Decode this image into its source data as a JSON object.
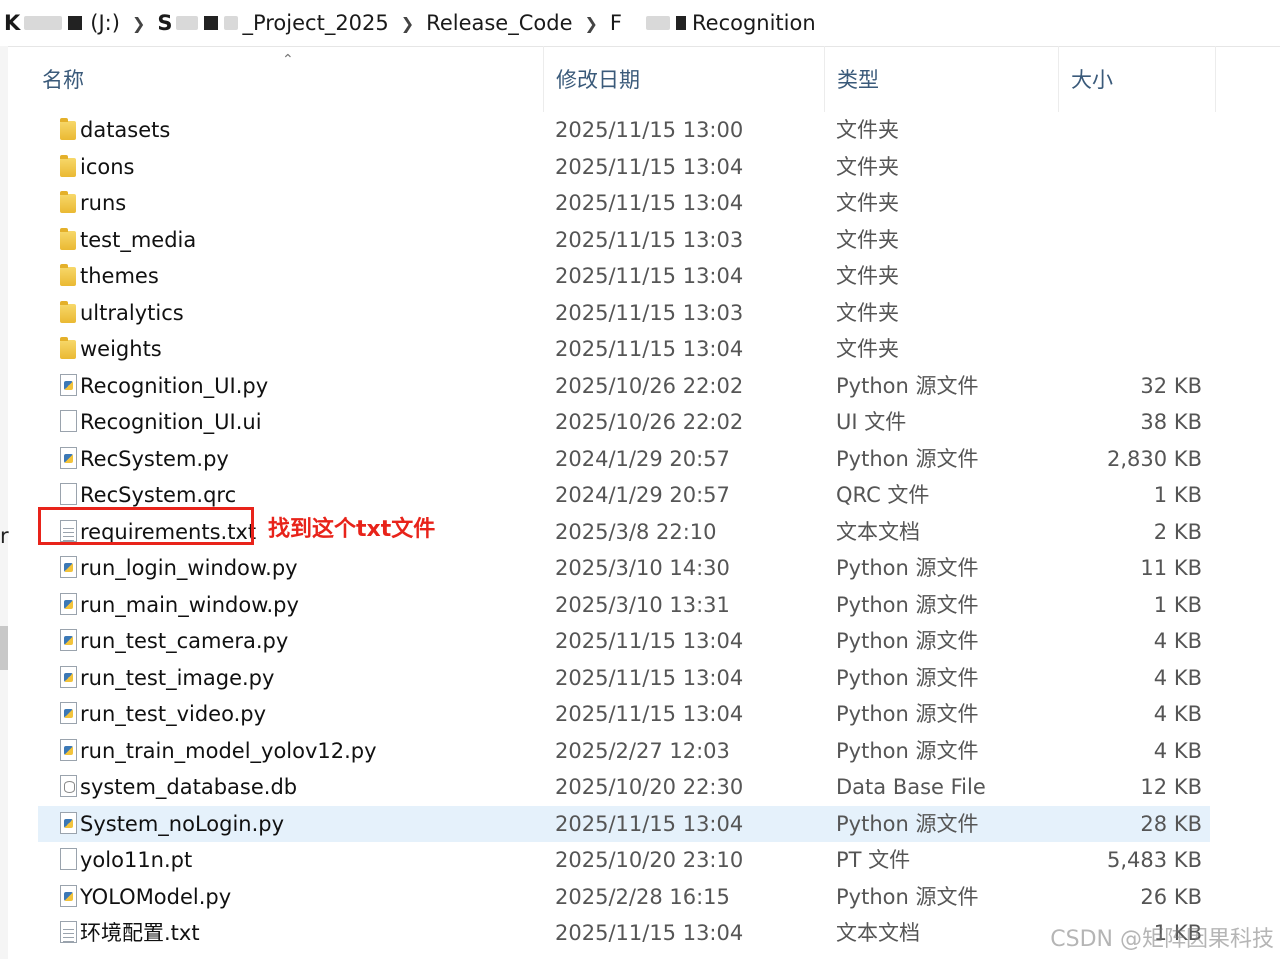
{
  "breadcrumb": {
    "drive": "(J:)",
    "project": "_Project_2025",
    "folder": "Release_Code",
    "sub": "F",
    "current": "Recognition"
  },
  "columns": {
    "name": "名称",
    "date": "修改日期",
    "type": "类型",
    "size": "大小"
  },
  "files": [
    {
      "icon": "folder",
      "name": "datasets",
      "date": "2025/11/15 13:00",
      "type": "文件夹",
      "size": ""
    },
    {
      "icon": "folder",
      "name": "icons",
      "date": "2025/11/15 13:04",
      "type": "文件夹",
      "size": ""
    },
    {
      "icon": "folder",
      "name": "runs",
      "date": "2025/11/15 13:04",
      "type": "文件夹",
      "size": ""
    },
    {
      "icon": "folder",
      "name": "test_media",
      "date": "2025/11/15 13:03",
      "type": "文件夹",
      "size": ""
    },
    {
      "icon": "folder",
      "name": "themes",
      "date": "2025/11/15 13:04",
      "type": "文件夹",
      "size": ""
    },
    {
      "icon": "folder",
      "name": "ultralytics",
      "date": "2025/11/15 13:03",
      "type": "文件夹",
      "size": ""
    },
    {
      "icon": "folder",
      "name": "weights",
      "date": "2025/11/15 13:04",
      "type": "文件夹",
      "size": ""
    },
    {
      "icon": "python",
      "name": "Recognition_UI.py",
      "date": "2025/10/26 22:02",
      "type": "Python 源文件",
      "size": "32 KB"
    },
    {
      "icon": "file",
      "name": "Recognition_UI.ui",
      "date": "2025/10/26 22:02",
      "type": "UI 文件",
      "size": "38 KB"
    },
    {
      "icon": "python",
      "name": "RecSystem.py",
      "date": "2024/1/29 20:57",
      "type": "Python 源文件",
      "size": "2,830 KB"
    },
    {
      "icon": "file",
      "name": "RecSystem.qrc",
      "date": "2024/1/29 20:57",
      "type": "QRC 文件",
      "size": "1 KB"
    },
    {
      "icon": "text",
      "name": "requirements.txt",
      "date": "2025/3/8 22:10",
      "type": "文本文档",
      "size": "2 KB"
    },
    {
      "icon": "python",
      "name": "run_login_window.py",
      "date": "2025/3/10 14:30",
      "type": "Python 源文件",
      "size": "11 KB"
    },
    {
      "icon": "python",
      "name": "run_main_window.py",
      "date": "2025/3/10 13:31",
      "type": "Python 源文件",
      "size": "1 KB"
    },
    {
      "icon": "python",
      "name": "run_test_camera.py",
      "date": "2025/11/15 13:04",
      "type": "Python 源文件",
      "size": "4 KB"
    },
    {
      "icon": "python",
      "name": "run_test_image.py",
      "date": "2025/11/15 13:04",
      "type": "Python 源文件",
      "size": "4 KB"
    },
    {
      "icon": "python",
      "name": "run_test_video.py",
      "date": "2025/11/15 13:04",
      "type": "Python 源文件",
      "size": "4 KB"
    },
    {
      "icon": "python",
      "name": "run_train_model_yolov12.py",
      "date": "2025/2/27 12:03",
      "type": "Python 源文件",
      "size": "4 KB"
    },
    {
      "icon": "database",
      "name": "system_database.db",
      "date": "2025/10/20 22:30",
      "type": "Data Base File",
      "size": "12 KB"
    },
    {
      "icon": "python",
      "name": "System_noLogin.py",
      "date": "2025/11/15 13:04",
      "type": "Python 源文件",
      "size": "28 KB",
      "selected": true
    },
    {
      "icon": "file",
      "name": "yolo11n.pt",
      "date": "2025/10/20 23:10",
      "type": "PT 文件",
      "size": "5,483 KB"
    },
    {
      "icon": "python",
      "name": "YOLOModel.py",
      "date": "2025/2/28 16:15",
      "type": "Python 源文件",
      "size": "26 KB"
    },
    {
      "icon": "text",
      "name": "环境配置.txt",
      "date": "2025/11/15 13:04",
      "type": "文本文档",
      "size": "1 KB"
    }
  ],
  "annotation": "找到这个txt文件",
  "watermark": "CSDN @矩阵因果科技",
  "stray_char": "r"
}
